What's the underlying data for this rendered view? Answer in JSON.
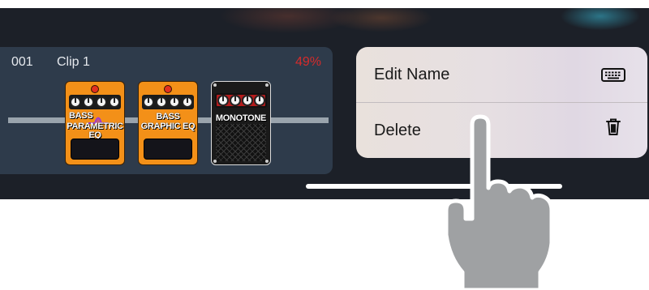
{
  "clip": {
    "number": "001",
    "name": "Clip 1",
    "percent": "49%"
  },
  "pedals": [
    {
      "line1": "BASS",
      "line2": "PARAMETRIC EQ"
    },
    {
      "line1": "BASS",
      "line2": "GRAPHIC EQ"
    },
    {
      "line1": "MONOTONE",
      "line2": ""
    }
  ],
  "context_menu": {
    "items": [
      {
        "label": "Edit Name",
        "icon": "keyboard-icon"
      },
      {
        "label": "Delete",
        "icon": "trash-icon"
      }
    ]
  },
  "colors": {
    "background": "#1c2028",
    "clip_card": "#2e3b4b",
    "percent": "#d62b2b",
    "pedal_orange": "#f39018",
    "menu_bg": "#e6dfe2"
  }
}
